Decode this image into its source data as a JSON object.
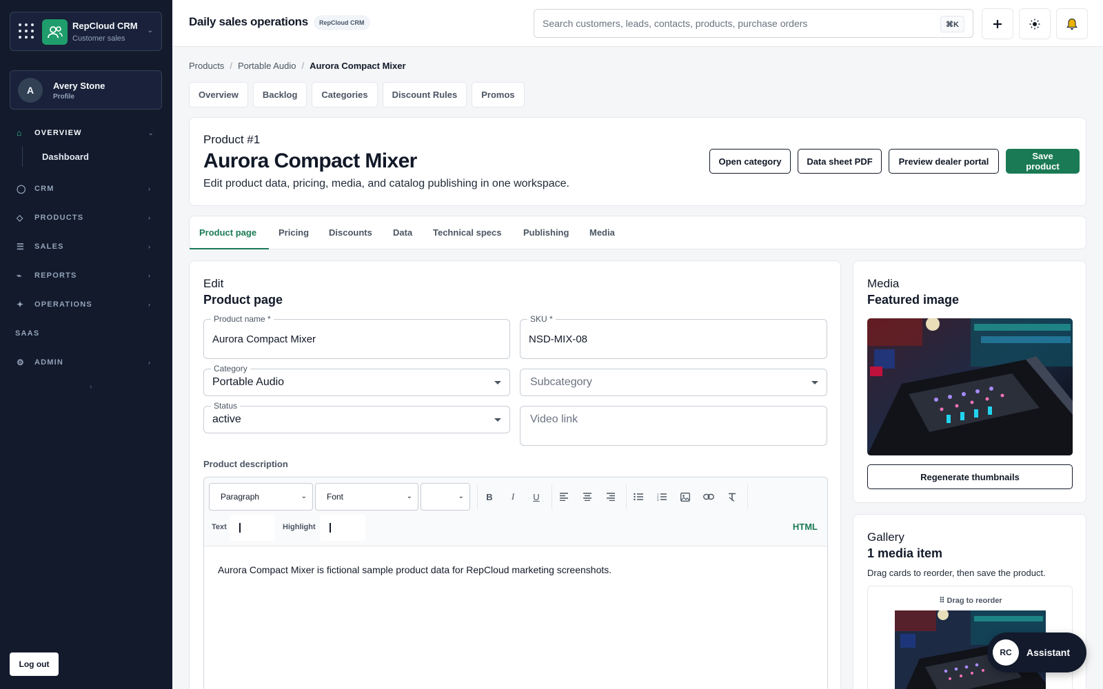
{
  "app": {
    "name": "RepCloud CRM",
    "subtitle": "Customer sales"
  },
  "profile": {
    "initial": "A",
    "name": "Avery Stone",
    "label": "Profile"
  },
  "nav": {
    "overview": "OVERVIEW",
    "dashboard": "Dashboard",
    "crm": "CRM",
    "products": "PRODUCTS",
    "sales": "SALES",
    "reports": "REPORTS",
    "operations": "OPERATIONS",
    "saas": "SAAS",
    "admin": "ADMIN",
    "logout": "Log out"
  },
  "topbar": {
    "title": "Daily sales operations",
    "badge": "RepCloud CRM",
    "search_placeholder": "Search customers, leads, contacts, products, purchase orders",
    "shortcut": "⌘K"
  },
  "breadcrumb": [
    "Products",
    "Portable Audio",
    "Aurora Compact Mixer"
  ],
  "subnav": [
    "Overview",
    "Backlog",
    "Categories",
    "Discount Rules",
    "Promos"
  ],
  "header": {
    "number": "Product #1",
    "title": "Aurora Compact Mixer",
    "description": "Edit product data, pricing, media, and catalog publishing in one workspace.",
    "buttons": {
      "open_category": "Open category",
      "data_sheet": "Data sheet PDF",
      "preview": "Preview dealer portal",
      "save": "Save product"
    }
  },
  "tabs": [
    "Product page",
    "Pricing",
    "Discounts",
    "Data",
    "Technical specs",
    "Publishing",
    "Media"
  ],
  "edit": {
    "kicker": "Edit",
    "heading": "Product page",
    "product_name_label": "Product name *",
    "product_name": "Aurora Compact Mixer",
    "sku_label": "SKU *",
    "sku": "NSD-MIX-08",
    "category_label": "Category",
    "category": "Portable Audio",
    "subcategory_placeholder": "Subcategory",
    "status_label": "Status",
    "status": "active",
    "video_placeholder": "Video link",
    "description_label": "Product description",
    "toolbar": {
      "block": "Paragraph",
      "font": "Font",
      "text_label": "Text",
      "highlight_label": "Highlight",
      "html_label": "HTML"
    },
    "description_text": "Aurora Compact Mixer is fictional sample product data for RepCloud marketing screenshots."
  },
  "media": {
    "kicker": "Media",
    "heading": "Featured image",
    "regenerate": "Regenerate thumbnails"
  },
  "gallery": {
    "kicker": "Gallery",
    "heading": "1 media item",
    "note": "Drag cards to reorder, then save the product.",
    "drag_label": "Drag to reorder"
  },
  "assistant": {
    "badge": "RC",
    "label": "Assistant"
  },
  "colors": {
    "accent": "#1a7a55",
    "sidebar": "#121a2c"
  }
}
